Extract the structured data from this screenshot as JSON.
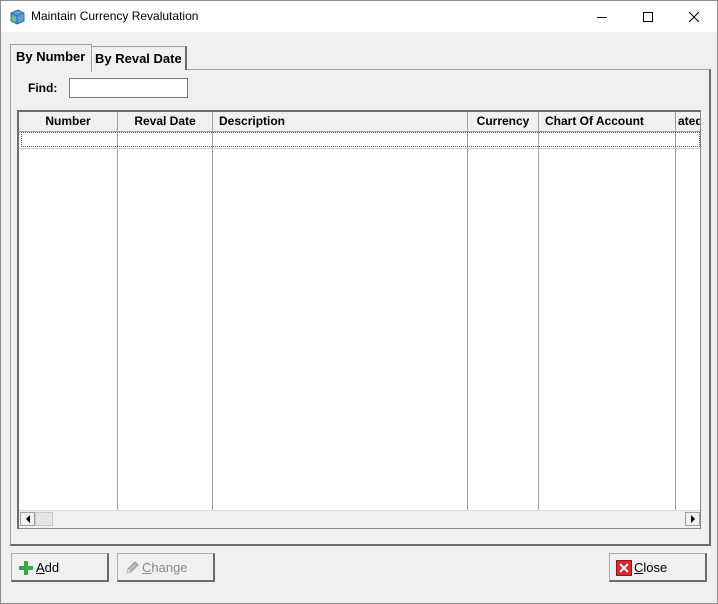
{
  "window": {
    "title": "Maintain Currency Revalutation",
    "controls": [
      "minimize-icon",
      "maximize-icon",
      "close-icon"
    ]
  },
  "tabs": [
    {
      "label": "By Number",
      "active": true
    },
    {
      "label": "By Reval Date",
      "active": false
    }
  ],
  "find": {
    "label": "Find:",
    "value": ""
  },
  "grid": {
    "columns": [
      "Number",
      "Reval Date",
      "Description",
      "Currency",
      "Chart Of Account",
      "ated"
    ],
    "rows": []
  },
  "buttons": {
    "add": {
      "first": "A",
      "rest": "dd",
      "icon": "plus-icon",
      "enabled": true
    },
    "change": {
      "first": "C",
      "rest": "hange",
      "icon": "pencil-icon",
      "enabled": false
    },
    "close": {
      "first": "C",
      "rest": "lose",
      "icon": "close-x-icon",
      "enabled": true
    }
  },
  "colors": {
    "accent_green": "#3fa34d",
    "close_red": "#d9262c"
  }
}
